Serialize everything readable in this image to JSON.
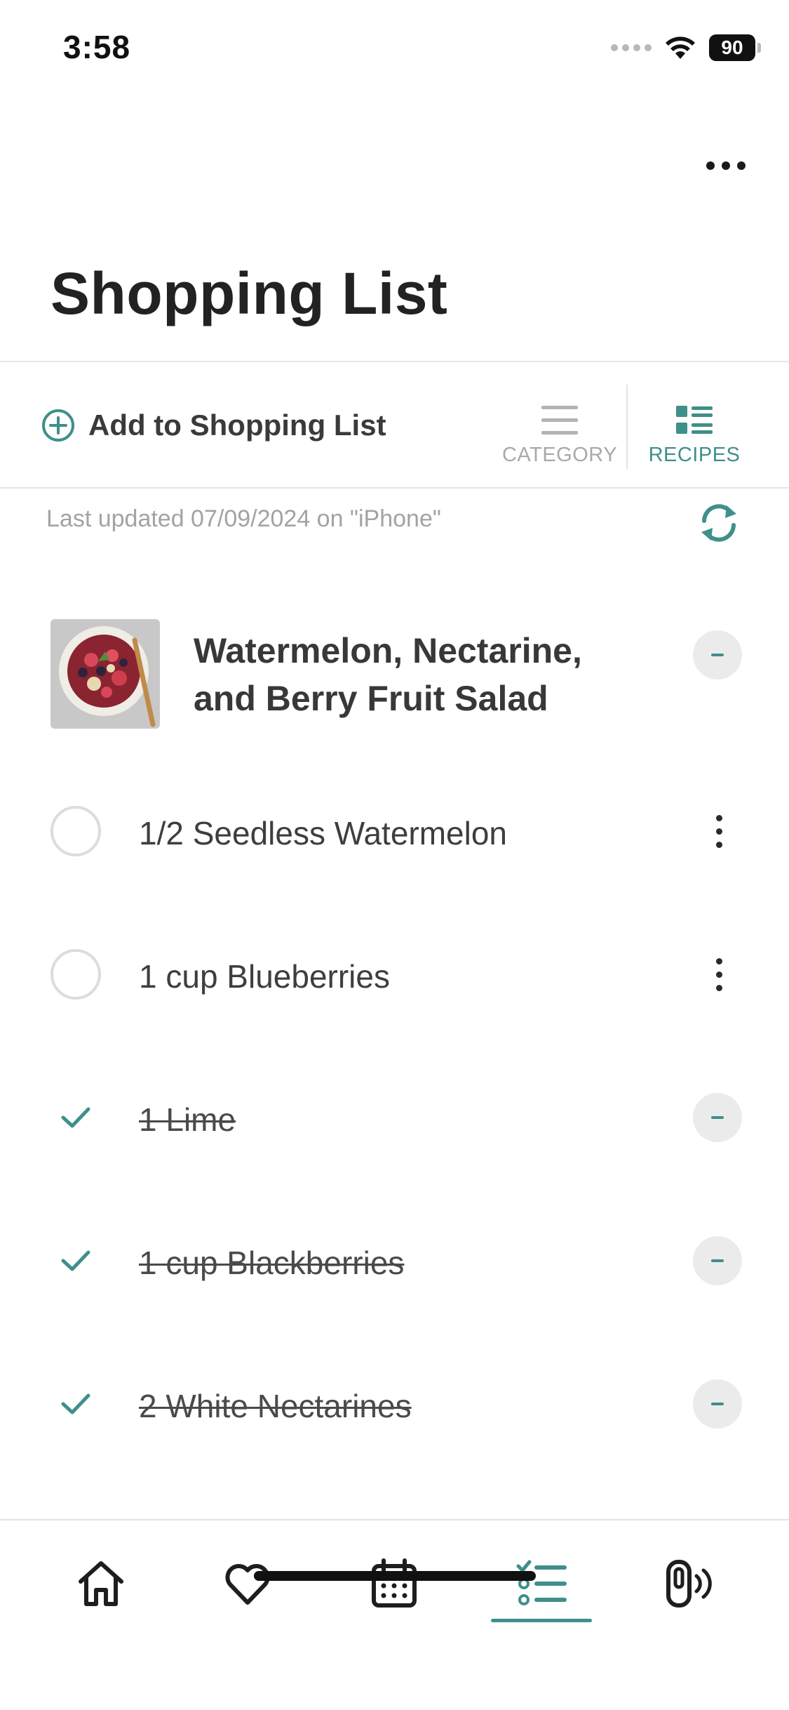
{
  "status_bar": {
    "time": "3:58",
    "battery": "90"
  },
  "header": {
    "title": "Shopping List"
  },
  "toolbar": {
    "add_label": "Add to Shopping List",
    "category_label": "CATEGORY",
    "recipes_label": "RECIPES",
    "active_view": "recipes"
  },
  "sync": {
    "last_updated": "Last updated 07/09/2024 on \"iPhone\""
  },
  "recipe": {
    "title": "Watermelon, Nectarine, and Berry Fruit Salad",
    "image": "fruit-salad-bowl-photo"
  },
  "items": [
    {
      "label": "1/2 Seedless Watermelon",
      "checked": false
    },
    {
      "label": "1 cup Blueberries",
      "checked": false
    },
    {
      "label": "1 Lime",
      "checked": true
    },
    {
      "label": "1 cup Blackberries",
      "checked": true
    },
    {
      "label": "2 White Nectarines",
      "checked": true
    }
  ],
  "tab_bar": {
    "tabs": [
      "home-icon",
      "heart-icon",
      "calendar-icon",
      "checklist-icon",
      "device-icon"
    ],
    "active_tab": "checklist-icon"
  },
  "colors": {
    "accent": "#3f8f8a",
    "muted": "#a9a9a9",
    "text": "#2b2b2b"
  }
}
